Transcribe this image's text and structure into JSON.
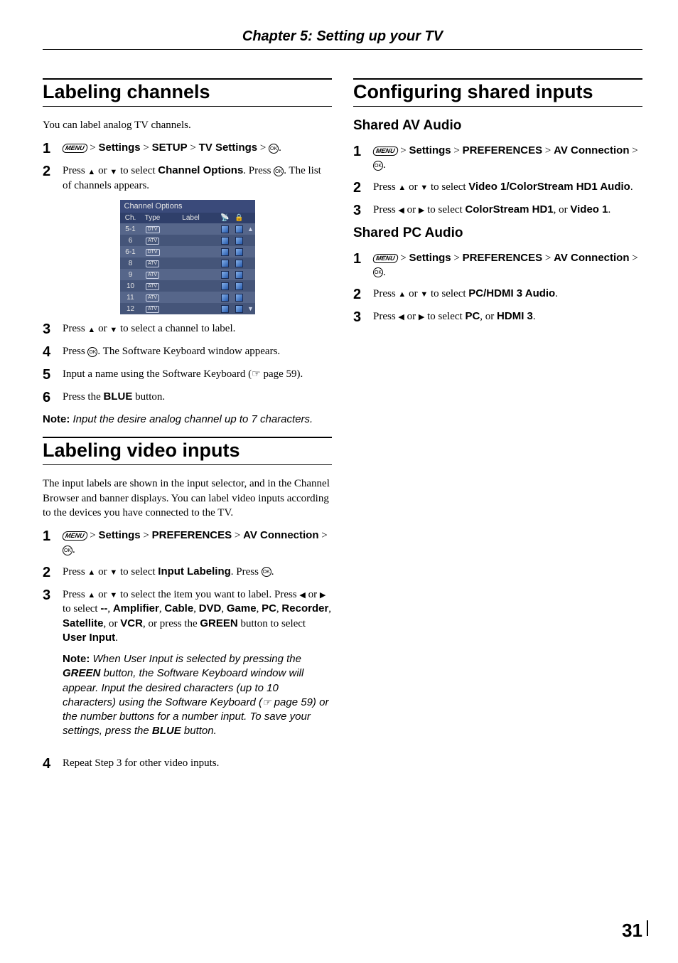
{
  "chapter_header": "Chapter 5: Setting up your TV",
  "page_number": "31",
  "left": {
    "h1a": "Labeling channels",
    "intro_a": "You can label analog TV channels.",
    "steps_a": {
      "s1": {
        "n": "1",
        "settings": "Settings",
        "setup": "SETUP",
        "tv": "TV Settings"
      },
      "s2": {
        "n": "2",
        "pre": "Press ",
        "mid": " to select ",
        "bold": "Channel Options",
        "post1": ". Press ",
        "post2": ". The list of channels appears."
      },
      "s3": {
        "n": "3",
        "pre": "Press ",
        "mid": " to select a channel to label."
      },
      "s4": {
        "n": "4",
        "pre": "Press ",
        "post": ". The Software Keyboard window appears."
      },
      "s5": {
        "n": "5",
        "pre": "Input a name using the Software Keyboard (",
        "post": " page 59)."
      },
      "s6": {
        "n": "6",
        "pre": "Press the ",
        "bold": "BLUE",
        "post": " button."
      }
    },
    "note_a": {
      "label": "Note:",
      "text": " Input the desire analog channel up to 7 characters."
    },
    "h1b": "Labeling video inputs",
    "intro_b": "The input labels are shown in the input selector, and in the Channel Browser and banner displays. You can label video inputs according to the devices you have connected to the TV.",
    "steps_b": {
      "s1": {
        "n": "1",
        "settings": "Settings",
        "prefs": "PREFERENCES",
        "av": "AV Connection"
      },
      "s2": {
        "n": "2",
        "pre": "Press ",
        "mid": " to select ",
        "bold": "Input Labeling",
        "post1": ". Press ",
        "post2": "."
      },
      "s3": {
        "n": "3",
        "l1a": "Press ",
        "l1b": " to select the item you want to label. Press ",
        "l1c": " to select ",
        "dashes": "--",
        "c1": "Amplifier",
        "c2": "Cable",
        "c3": "DVD",
        "c4": "Game",
        "c5": "PC",
        "c6": "Recorder",
        "c7": "Satellite",
        "c8": "VCR",
        "l1d": ", or press the ",
        "green": "GREEN",
        "l1e": " button to select ",
        "ui": "User Input",
        "l1f": "."
      },
      "s4": {
        "n": "4",
        "text": "Repeat Step 3 for other video inputs."
      }
    },
    "note_b": {
      "label": "Note:",
      "t1": " When User Input is selected by pressing the ",
      "green": "GREEN",
      "t2": " button, the Software Keyboard window will appear. Input the desired characters (up to 10 characters) using the Software Keyboard (",
      "t3": " page 59) or the number buttons for a number input. To save your settings, press the ",
      "blue": "BLUE",
      "t4": " button."
    },
    "ch_table": {
      "title": "Channel Options",
      "headers": {
        "ch": "Ch.",
        "type": "Type",
        "label": "Label"
      },
      "rows": [
        {
          "ch": "5-1",
          "type": "DTV"
        },
        {
          "ch": "6",
          "type": "ATV"
        },
        {
          "ch": "6-1",
          "type": "DTV"
        },
        {
          "ch": "8",
          "type": "ATV"
        },
        {
          "ch": "9",
          "type": "ATV"
        },
        {
          "ch": "10",
          "type": "ATV"
        },
        {
          "ch": "11",
          "type": "ATV"
        },
        {
          "ch": "12",
          "type": "ATV"
        }
      ]
    }
  },
  "right": {
    "h1": "Configuring shared inputs",
    "h2a": "Shared AV Audio",
    "steps_a": {
      "s1": {
        "n": "1",
        "settings": "Settings",
        "prefs": "PREFERENCES",
        "av": "AV Connection"
      },
      "s2": {
        "n": "2",
        "pre": "Press ",
        "mid": " to select ",
        "bold": "Video 1/ColorStream HD1 Audio",
        "post": "."
      },
      "s3": {
        "n": "3",
        "pre": "Press ",
        "mid": " to select ",
        "b1": "ColorStream HD1",
        "sep": ", or ",
        "b2": "Video 1",
        "post": "."
      }
    },
    "h2b": "Shared PC Audio",
    "steps_b": {
      "s1": {
        "n": "1",
        "settings": "Settings",
        "prefs": "PREFERENCES",
        "av": "AV Connection"
      },
      "s2": {
        "n": "2",
        "pre": "Press ",
        "mid": " to select ",
        "bold": "PC/HDMI 3 Audio",
        "post": "."
      },
      "s3": {
        "n": "3",
        "pre": "Press ",
        "mid": " to select ",
        "b1": "PC",
        "sep": ", or ",
        "b2": "HDMI 3",
        "post": "."
      }
    }
  }
}
